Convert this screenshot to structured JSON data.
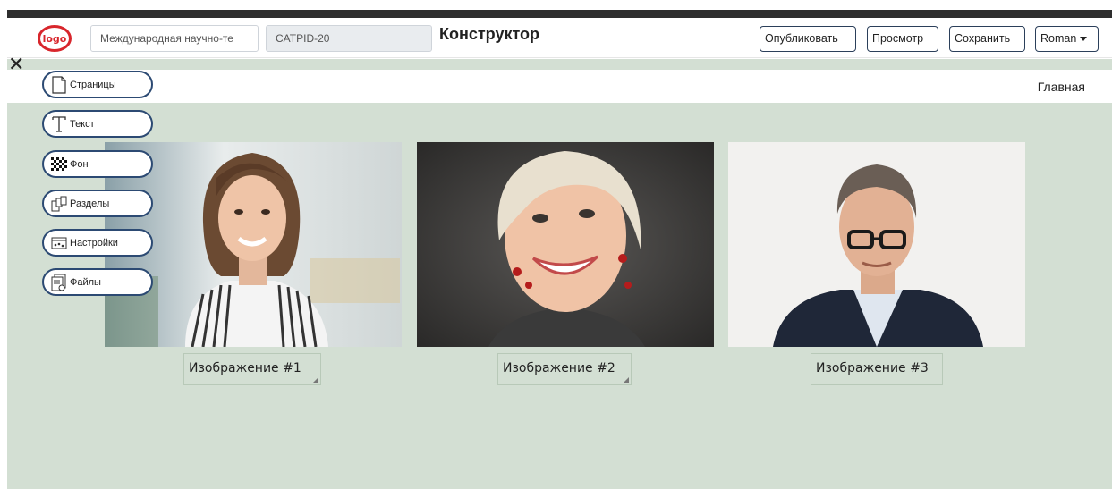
{
  "header": {
    "logo_text": "logo",
    "org_field": "Международная научно-те",
    "code_field": "CATPID-20",
    "title": "Конструктор",
    "publish_label": "Опубликовать",
    "preview_label": "Просмотр",
    "save_label": "Сохранить",
    "user_label": "Roman"
  },
  "close_glyph": "✕",
  "nav": {
    "home": "Главная"
  },
  "tools": [
    {
      "label": "Страницы",
      "icon": "page-icon"
    },
    {
      "label": "Текст",
      "icon": "text-icon"
    },
    {
      "label": "Фон",
      "icon": "checker-icon"
    },
    {
      "label": "Разделы",
      "icon": "sections-icon"
    },
    {
      "label": "Настройки",
      "icon": "settings-icon"
    },
    {
      "label": "Файлы",
      "icon": "files-icon"
    }
  ],
  "images": [
    {
      "caption": "Изображение #1"
    },
    {
      "caption": "Изображение #2"
    },
    {
      "caption": "Изображение #3"
    }
  ],
  "colors": {
    "brand": "#d8262c",
    "canvas": "#d3dfd3",
    "tool_border": "#2c4a73"
  }
}
